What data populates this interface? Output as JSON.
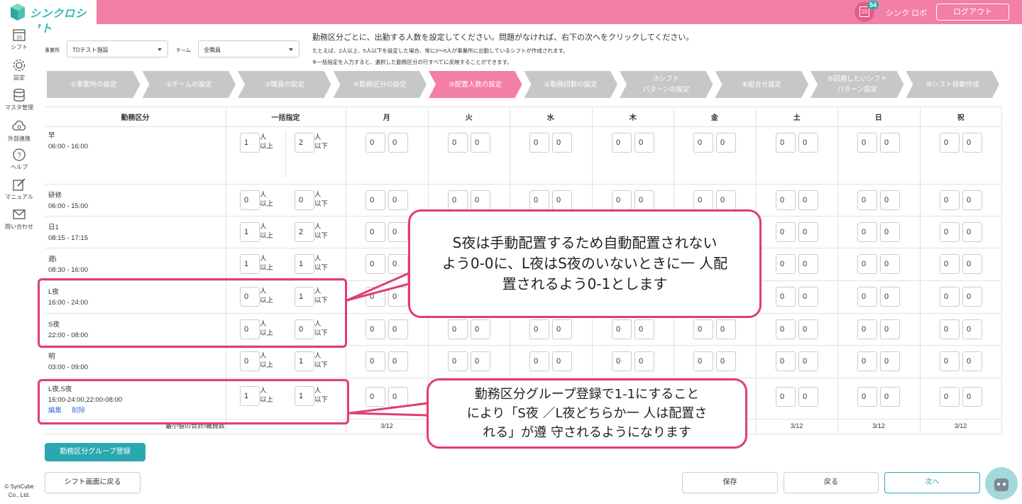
{
  "header": {
    "logo_text": "シンクロシフト",
    "notification_day": "15",
    "notification_count": "54",
    "user_name": "シンク ロボ",
    "logout_label": "ログアウト"
  },
  "sidebar": {
    "shift_day": "15",
    "items": [
      {
        "label": "シフト"
      },
      {
        "label": "設定"
      },
      {
        "label": "マスタ管理"
      },
      {
        "label": "外部連携"
      },
      {
        "label": "ヘルプ"
      },
      {
        "label": "マニュアル"
      },
      {
        "label": "問い合わせ"
      }
    ],
    "copyright_line1": "© SynCube",
    "copyright_line2": "Co., Ltd."
  },
  "filters": {
    "office_label": "事業所",
    "office_value": "TDテスト施設",
    "team_label": "チーム",
    "team_value": "全職員"
  },
  "info": {
    "main": "勤務区分ごとに、出勤する人数を設定してください。問題がなければ、右下の次へをクリックしてください。",
    "sub1": "たとえば、2人以上、5人以下を設定した場合、常に2〜5人が事業所に出勤しているシフトが作成されます。",
    "sub2": "※一括指定を入力すると、選択した勤務区分の行すべてに反映することができます。"
  },
  "steps": [
    {
      "label": "①事業所の設定",
      "active": false
    },
    {
      "label": "②チームの設定",
      "active": false
    },
    {
      "label": "③職員の設定",
      "active": false
    },
    {
      "label": "④勤務区分の設定",
      "active": false
    },
    {
      "label": "⑤配置人数の設定",
      "active": true
    },
    {
      "label": "⑥勤務回数の設定",
      "active": false
    },
    {
      "label": "⑦シフト\nパターンの設定",
      "active": false
    },
    {
      "label": "⑧組合せ設定",
      "active": false
    },
    {
      "label": "⑨回避したいシフト\nパターン設定",
      "active": false
    },
    {
      "label": "⑩シフト自動作成",
      "active": false
    }
  ],
  "table": {
    "col_shift": "勤務区分",
    "col_bulk": "一括指定",
    "days": [
      "月",
      "火",
      "水",
      "木",
      "金",
      "土",
      "日",
      "祝"
    ],
    "unit_min_a": "人",
    "unit_min_b": "以上",
    "unit_max_a": "人",
    "unit_max_b": "以下",
    "edit_label": "編集",
    "delete_label": "削除",
    "rows": [
      {
        "name": "早",
        "time": "06:00 - 16:00",
        "bulk_min": "1",
        "bulk_max": "2",
        "min": "0",
        "max": "0"
      },
      {
        "name": "研修",
        "time": "06:00 - 15:00",
        "bulk_min": "0",
        "bulk_max": "0",
        "min": "0",
        "max": "0"
      },
      {
        "name": "日1",
        "time": "08:15 - 17:15",
        "bulk_min": "1",
        "bulk_max": "2",
        "min": "0",
        "max": "0"
      },
      {
        "name": "遅i",
        "time": "08:30 - 16:00",
        "bulk_min": "1",
        "bulk_max": "1",
        "min": "0",
        "max": "0"
      },
      {
        "name": "L夜",
        "time": "16:00 - 24:00",
        "bulk_min": "0",
        "bulk_max": "1",
        "min": "0",
        "max": "0"
      },
      {
        "name": "S夜",
        "time": "22:00 - 08:00",
        "bulk_min": "0",
        "bulk_max": "0",
        "min": "0",
        "max": "0"
      },
      {
        "name": "明",
        "time": "03:00 - 09:00",
        "bulk_min": "0",
        "bulk_max": "1",
        "min": "0",
        "max": "0"
      },
      {
        "name": "L夜,S夜",
        "time": "16:00-24:00,22:00-08:00",
        "bulk_min": "1",
        "bulk_max": "1",
        "min": "0",
        "max": "0"
      }
    ],
    "footer_label": "最小値の合計/職員数",
    "ratios": [
      "3/12",
      "3/12",
      "3/12",
      "3/12"
    ]
  },
  "buttons": {
    "group_register": "勤務区分グループ登録",
    "back_to_shift": "シフト画面に戻る",
    "save": "保存",
    "back": "戻る",
    "next": "次へ"
  },
  "callouts": {
    "top": "S夜は手動配置するため自動配置されない\nよう0-0に、L夜はS夜のいないときに一 人配\n置されるよう0-1とします",
    "bottom": "勤務区分グループ登録で1-1にすること\nにより「S夜 ／L夜どちらか一 人は配置さ\nれる」が遵 守されるようになります"
  },
  "colors": {
    "brand_pink": "#f47fa6",
    "accent_teal": "#2aa8b1",
    "annotation_red": "#e23e6d"
  }
}
